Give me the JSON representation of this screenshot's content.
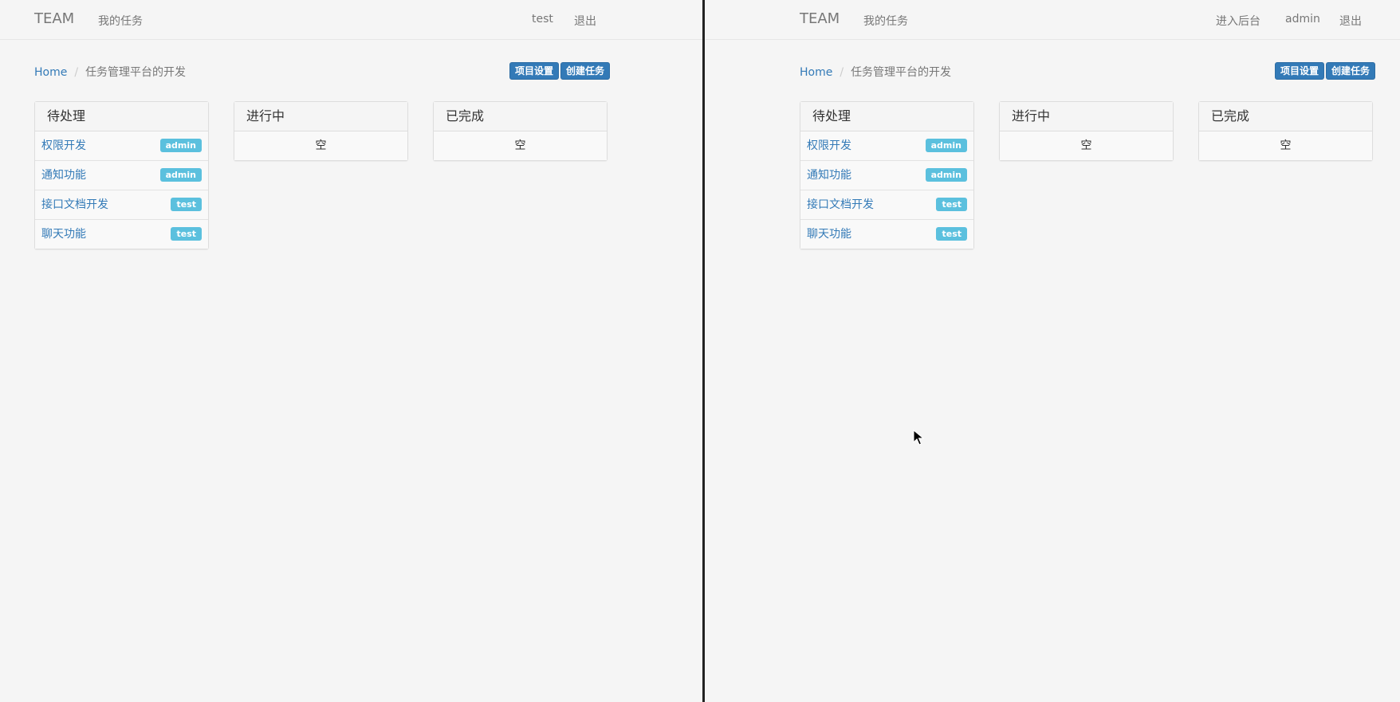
{
  "left_window": {
    "navbar": {
      "brand": "TEAM",
      "links": [
        "我的任务"
      ],
      "right_links": [
        "test",
        "退出"
      ]
    },
    "breadcrumb": {
      "home": "Home",
      "current": "任务管理平台的开发"
    },
    "buttons": {
      "settings": "项目设置",
      "create": "创建任务"
    },
    "columns": [
      {
        "title": "待处理",
        "tasks": [
          {
            "name": "权限开发",
            "assignee": "admin"
          },
          {
            "name": "通知功能",
            "assignee": "admin"
          },
          {
            "name": "接口文档开发",
            "assignee": "test"
          },
          {
            "name": "聊天功能",
            "assignee": "test"
          }
        ]
      },
      {
        "title": "进行中",
        "empty": "空"
      },
      {
        "title": "已完成",
        "empty": "空"
      }
    ]
  },
  "right_window": {
    "navbar": {
      "brand": "TEAM",
      "links": [
        "我的任务"
      ],
      "right_links": [
        "进入后台",
        "admin",
        "退出"
      ]
    },
    "breadcrumb": {
      "home": "Home",
      "current": "任务管理平台的开发"
    },
    "buttons": {
      "settings": "项目设置",
      "create": "创建任务"
    },
    "columns": [
      {
        "title": "待处理",
        "tasks": [
          {
            "name": "权限开发",
            "assignee": "admin"
          },
          {
            "name": "通知功能",
            "assignee": "admin"
          },
          {
            "name": "接口文档开发",
            "assignee": "test"
          },
          {
            "name": "聊天功能",
            "assignee": "test"
          }
        ]
      },
      {
        "title": "进行中",
        "empty": "空"
      },
      {
        "title": "已完成",
        "empty": "空"
      }
    ]
  },
  "colors": {
    "primary": "#337ab7",
    "info_badge": "#5bc0de",
    "background": "#f5f5f5"
  },
  "icons": {
    "cursor": "mouse-pointer-icon"
  }
}
